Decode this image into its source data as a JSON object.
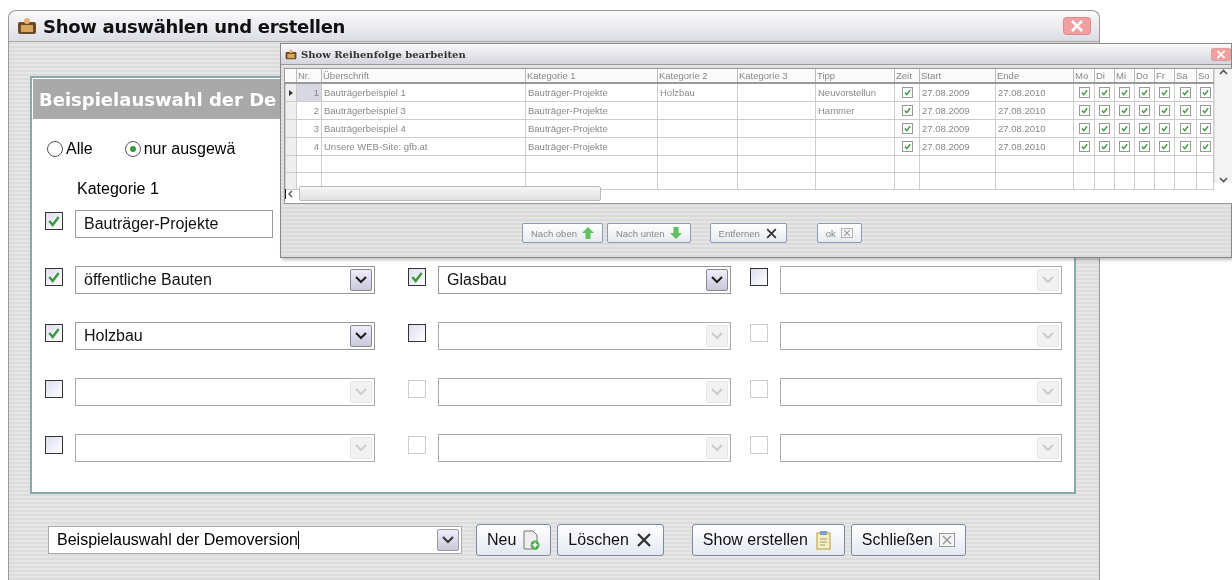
{
  "window": {
    "title": "Show auswählen und erstellen"
  },
  "panel": {
    "title": "Beispielauswahl der De",
    "radios": [
      {
        "label": "Alle",
        "selected": false
      },
      {
        "label": "nur ausgewä",
        "selected": true
      }
    ],
    "category_labels": [
      "Kategorie 1"
    ],
    "rows": [
      [
        {
          "checked": true,
          "disabled": false,
          "value": "Bauträger-Projekte"
        }
      ],
      [
        {
          "checked": true,
          "disabled": false,
          "value": "öffentliche Bauten"
        },
        {
          "checked": true,
          "disabled": false,
          "value": "Glasbau"
        },
        {
          "checked": false,
          "disabled": false
        }
      ],
      [
        {
          "checked": true,
          "disabled": false,
          "value": "Holzbau"
        },
        {
          "checked": false,
          "disabled": false
        },
        {
          "checked": false,
          "disabled": true
        }
      ],
      [
        {
          "checked": false,
          "disabled": false
        },
        {
          "checked": false,
          "disabled": true
        },
        {
          "checked": false,
          "disabled": true
        }
      ],
      [
        {
          "checked": false,
          "disabled": false
        },
        {
          "checked": false,
          "disabled": true
        },
        {
          "checked": false,
          "disabled": true
        }
      ]
    ]
  },
  "selection": {
    "value": "Beispielauswahl der Demoversion"
  },
  "buttons": [
    "Neu",
    "Löschen",
    "Show erstellen",
    "Schließen"
  ],
  "dialog": {
    "title": "Show Reihenfolge bearbeiten",
    "columns": [
      "Nr.",
      "Überschrift",
      "Kategorie 1",
      "Kategorie 2",
      "Kategorie 3",
      "Tipp",
      "Zeit",
      "Start",
      "Ende",
      "Mo",
      "Di",
      "Mi",
      "Do",
      "Fr",
      "Sa",
      "So"
    ],
    "rows": [
      {
        "selected": true,
        "nr": "1",
        "title": "Bauträgerbeispiel 1",
        "kategorie_1": "Bauträger-Projekte",
        "kategorie_2": "Holzbau",
        "tipp": "Neuvorstellun",
        "zeit": true,
        "start": "27.08.2009",
        "ende": "27.08.2010",
        "days": [
          true,
          true,
          true,
          true,
          true,
          true,
          true
        ]
      },
      {
        "selected": false,
        "nr": "2",
        "title": "Bauträgerbeispiel 3",
        "kategorie_1": "Bauträger-Projekte",
        "tipp": "Hammer",
        "zeit": true,
        "start": "27.08.2009",
        "ende": "27.08.2010",
        "days": [
          true,
          true,
          true,
          true,
          true,
          true,
          true
        ]
      },
      {
        "selected": false,
        "nr": "3",
        "title": "Bauträgerbeispiel 4",
        "kategorie_1": "Bauträger-Projekte",
        "zeit": true,
        "start": "27.08.2009",
        "ende": "27.08.2010",
        "days": [
          true,
          true,
          true,
          true,
          true,
          true,
          true
        ]
      },
      {
        "selected": false,
        "nr": "4",
        "title": "Unsere WEB-Site: gfb.at",
        "kategorie_1": "Bauträger-Projekte",
        "zeit": true,
        "start": "27.08.2009",
        "ende": "27.08.2010",
        "days": [
          true,
          true,
          true,
          true,
          true,
          true,
          true
        ]
      }
    ],
    "buttons": [
      "Nach oben",
      "Nach unten",
      "Entfernen",
      "ok"
    ]
  }
}
